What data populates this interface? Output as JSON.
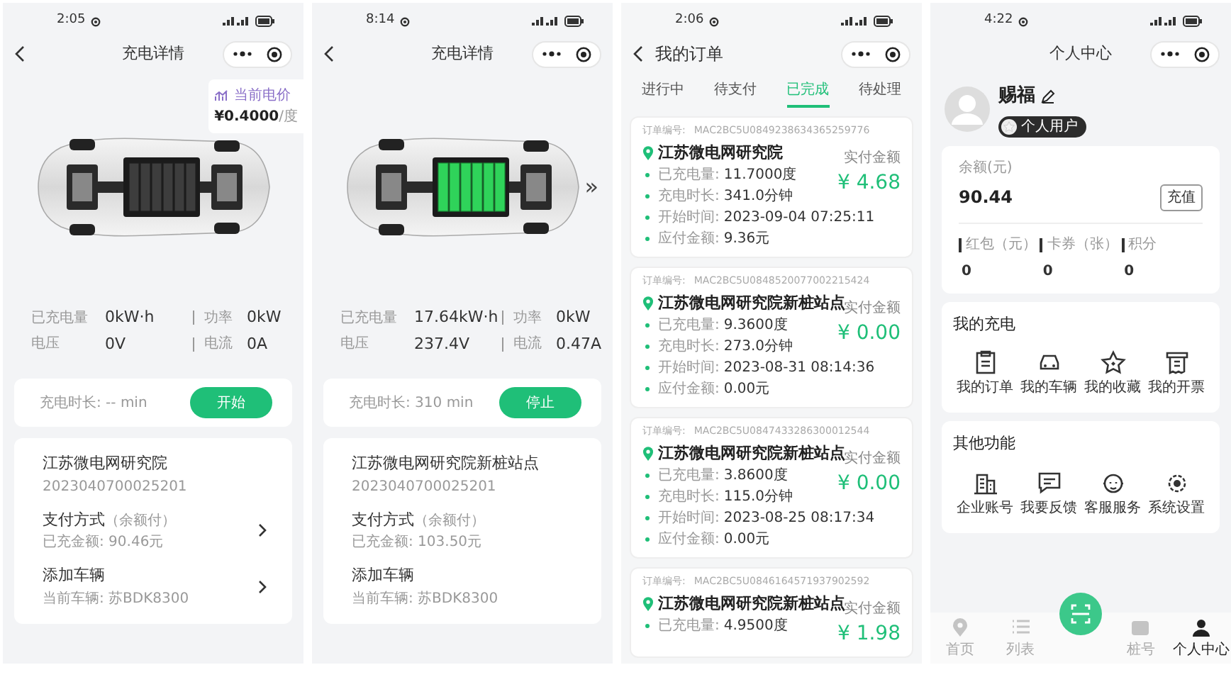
{
  "charging_screens": [
    {
      "status_time": "2:05",
      "title": "充电详情",
      "price": {
        "label": "当前电价",
        "value": "¥0.4000",
        "unit": "/度"
      },
      "charging": false,
      "stats": [
        {
          "label": "已充电量",
          "value": "0kW·h"
        },
        {
          "label": "功率",
          "value": "0kW"
        },
        {
          "label": "电压",
          "value": "0V"
        },
        {
          "label": "电流",
          "value": "0A"
        }
      ],
      "duration": "充电时长: -- min",
      "action": "开始",
      "station": {
        "name": "江苏微电网研究院",
        "code": "2023040700025201"
      },
      "payment": {
        "title": "支付方式",
        "note": "（余额付）",
        "detail": "已充金额: 90.46元"
      },
      "vehicle": {
        "title": "添加车辆",
        "detail": "当前车辆: 苏BDK8300"
      },
      "chevrons": true
    },
    {
      "status_time": "8:14",
      "title": "充电详情",
      "next_marker": "»",
      "charging": true,
      "stats": [
        {
          "label": "已充电量",
          "value": "17.64kW·h"
        },
        {
          "label": "功率",
          "value": "0kW"
        },
        {
          "label": "电压",
          "value": "237.4V"
        },
        {
          "label": "电流",
          "value": "0.47A"
        }
      ],
      "duration": "充电时长: 310 min",
      "action": "停止",
      "station": {
        "name": "江苏微电网研究院新桩站点",
        "code": "2023040700025201"
      },
      "payment": {
        "title": "支付方式",
        "note": "（余额付）",
        "detail": "已充金额: 103.50元"
      },
      "vehicle": {
        "title": "添加车辆",
        "detail": "当前车辆: 苏BDK8300"
      },
      "chevrons": false
    }
  ],
  "orders_screen": {
    "status_time": "2:06",
    "title": "我的订单",
    "tabs": [
      {
        "label": "进行中",
        "selected": false
      },
      {
        "label": "待支付",
        "selected": false
      },
      {
        "label": "已完成",
        "selected": true
      },
      {
        "label": "待处理",
        "selected": false
      }
    ],
    "orders": [
      {
        "number_label": "订单编号:",
        "number": "MAC2BC5U0849238634365259776",
        "station": "江苏微电网研究院",
        "lines": [
          {
            "label": "已充电量:",
            "value": "11.7000度"
          },
          {
            "label": "充电时长:",
            "value": "341.0分钟"
          },
          {
            "label": "开始时间:",
            "value": "2023-09-04 07:25:11"
          },
          {
            "label": "应付金额:",
            "value": "9.36元"
          }
        ],
        "paid_label": "实付金额",
        "paid": "¥ 4.68"
      },
      {
        "number_label": "订单编号:",
        "number": "MAC2BC5U0848520077002215424",
        "station": "江苏微电网研究院新桩站点",
        "lines": [
          {
            "label": "已充电量:",
            "value": "9.3600度"
          },
          {
            "label": "充电时长:",
            "value": "273.0分钟"
          },
          {
            "label": "开始时间:",
            "value": "2023-08-31 08:14:36"
          },
          {
            "label": "应付金额:",
            "value": "0.00元"
          }
        ],
        "paid_label": "实付金额",
        "paid": "¥ 0.00"
      },
      {
        "number_label": "订单编号:",
        "number": "MAC2BC5U0847433286300012544",
        "station": "江苏微电网研究院新桩站点",
        "lines": [
          {
            "label": "已充电量:",
            "value": "3.8600度"
          },
          {
            "label": "充电时长:",
            "value": "115.0分钟"
          },
          {
            "label": "开始时间:",
            "value": "2023-08-25 08:17:34"
          },
          {
            "label": "应付金额:",
            "value": "0.00元"
          }
        ],
        "paid_label": "实付金额",
        "paid": "¥ 0.00"
      },
      {
        "number_label": "订单编号:",
        "number": "MAC2BC5U0846164571937902592",
        "station": "江苏微电网研究院新桩站点",
        "lines": [
          {
            "label": "已充电量:",
            "value": "4.9500度"
          }
        ],
        "paid_label": "实付金额",
        "paid": "¥ 1.98"
      }
    ]
  },
  "profile_screen": {
    "status_time": "4:22",
    "title": "个人中心",
    "user_name": "赐福",
    "user_type": "个人用户",
    "balance_label": "余额(元)",
    "balance": "90.44",
    "recharge": "充值",
    "assets": [
      {
        "label": "红包（元）",
        "value": "0"
      },
      {
        "label": "卡券（张）",
        "value": "0"
      },
      {
        "label": "积分",
        "value": "0"
      }
    ],
    "sections": [
      {
        "title": "我的充电",
        "items": [
          "我的订单",
          "我的车辆",
          "我的收藏",
          "我的开票"
        ]
      },
      {
        "title": "其他功能",
        "items": [
          "企业账号",
          "我要反馈",
          "客服服务",
          "系统设置"
        ]
      }
    ],
    "nav": [
      {
        "label": "首页",
        "selected": false
      },
      {
        "label": "列表",
        "selected": false
      },
      {
        "label": "桩号",
        "selected": false
      },
      {
        "label": "个人中心",
        "selected": true
      }
    ]
  }
}
